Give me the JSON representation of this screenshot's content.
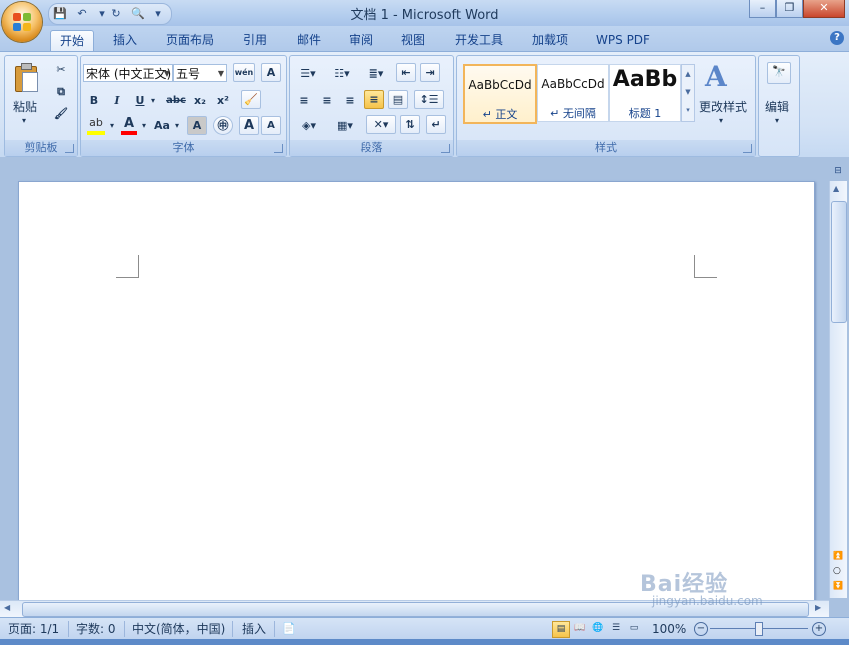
{
  "window": {
    "title": "文档 1 - Microsoft Word"
  },
  "tabs": [
    {
      "label": "开始",
      "active": true
    },
    {
      "label": "插入"
    },
    {
      "label": "页面布局"
    },
    {
      "label": "引用"
    },
    {
      "label": "邮件"
    },
    {
      "label": "审阅"
    },
    {
      "label": "视图"
    },
    {
      "label": "开发工具"
    },
    {
      "label": "加载项"
    },
    {
      "label": "WPS PDF"
    }
  ],
  "ribbon": {
    "clipboard": {
      "label": "剪贴板",
      "paste_label": "粘贴"
    },
    "font": {
      "label": "字体",
      "font_name": "宋体 (中文正文)",
      "font_size": "五号",
      "bold": "B",
      "italic": "I",
      "underline": "U",
      "strike": "abc",
      "subscript": "x₂",
      "superscript": "x²",
      "change_case": "Aa",
      "char_border": "A",
      "grow": "A",
      "shrink": "A",
      "phonetic": "wén",
      "clear_format": "A"
    },
    "paragraph": {
      "label": "段落"
    },
    "styles": {
      "label": "样式",
      "items": [
        {
          "preview": "AaBbCcDd",
          "name": "↵ 正文",
          "selected": true
        },
        {
          "preview": "AaBbCcDd",
          "name": "↵ 无间隔"
        },
        {
          "preview": "AaBb",
          "name": "标题 1"
        }
      ],
      "change_styles_label": "更改样式"
    },
    "editing": {
      "label": "编辑"
    }
  },
  "statusbar": {
    "page": "页面: 1/1",
    "words": "字数: 0",
    "language": "中文(简体，中国)",
    "insert_mode": "插入",
    "zoom": "100%"
  },
  "watermark": {
    "brand": "Bai经验",
    "url": "jingyan.baidu.com"
  },
  "colors": {
    "accent": "#15428b",
    "ribbon_bg": "#d3e2f5",
    "highlight_yellow": "#ffff00",
    "font_red": "#ff0000",
    "selected_style_border": "#f2b55a"
  }
}
